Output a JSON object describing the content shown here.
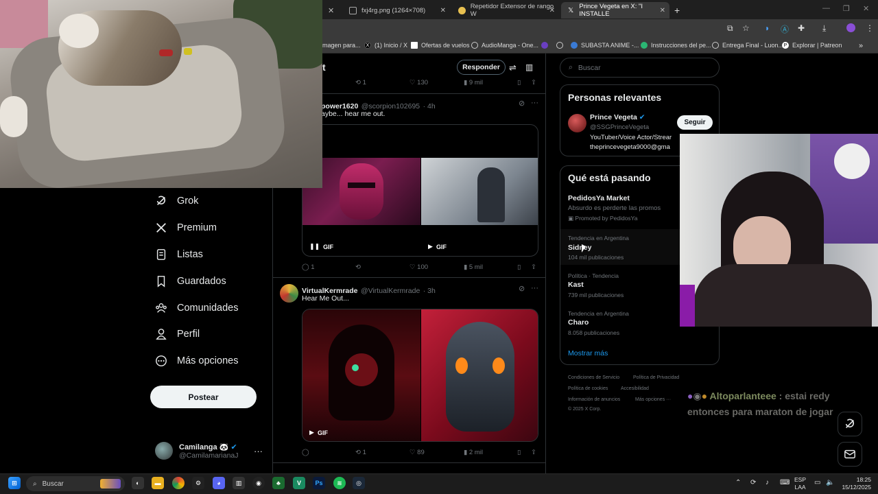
{
  "browser": {
    "tabs": [
      {
        "label": "fxj4rg.png (1264×708)"
      },
      {
        "label": "Repetidor Extensor de rango W"
      },
      {
        "label": "Prince Vegeta en X: \"I INSTALLE"
      }
    ],
    "new_tab": "+",
    "bookmarks": [
      "magen para...",
      "(1) Inicio / X",
      "Ofertas de vuelos",
      "AudioManga - One...",
      "SUBASTA ANIME -...",
      "Instrucciones del pe...",
      "Entrega Final - Luon...",
      "Explorar | Patreon"
    ]
  },
  "nav": {
    "items": [
      {
        "label": "Grok"
      },
      {
        "label": "Premium"
      },
      {
        "label": "Listas"
      },
      {
        "label": "Guardados"
      },
      {
        "label": "Comunidades"
      },
      {
        "label": "Perfil"
      },
      {
        "label": "Más opciones"
      }
    ],
    "post_button": "Postear",
    "profile": {
      "name": "Camilanga 🐼",
      "handle": "@CamilamarianaJ",
      "more": "···"
    }
  },
  "feed": {
    "header_fragment": "t",
    "reply_button": "Responder",
    "top_actions": {
      "reposts": "1",
      "likes": "130",
      "views": "9 mil"
    },
    "tweet1": {
      "name": "power1620",
      "handle": "@scorpion102695",
      "time": "· 4h",
      "text": "aybe... hear me out.",
      "gif_label_1": "GIF",
      "gif_label_2": "GIF",
      "replies": "1",
      "likes": "100",
      "views": "5 mil"
    },
    "tweet2": {
      "name": "VirtualKermrade",
      "handle": "@VirtualKermrade",
      "time": "· 3h",
      "text": "Hear Me Out...",
      "gif_label": "GIF",
      "reposts": "1",
      "likes": "89",
      "views": "2 mil"
    }
  },
  "sidebar_right": {
    "search_placeholder": "Buscar",
    "relevant_title": "Personas relevantes",
    "person": {
      "name": "Prince Vegeta",
      "handle": "@SSGPrinceVegeta",
      "bio_line1": "YouTuber/Voice Actor/Strear",
      "bio_line2": "theprincevegeta9000@gma",
      "follow": "Seguir"
    },
    "trends_title": "Qué está pasando",
    "trends": [
      {
        "category": "",
        "name": "PedidosYa Market",
        "count": "Absurdo es perderte las promos",
        "promoted": "Promoted by PedidosYa"
      },
      {
        "category": "Tendencia en Argentina",
        "name": "Sidney",
        "count": "104 mil publicaciones"
      },
      {
        "category": "Política · Tendencia",
        "name": "Kast",
        "count": "739 mil publicaciones"
      },
      {
        "category": "Tendencia en Argentina",
        "name": "Charo",
        "count": "8.058 publicaciones"
      }
    ],
    "show_more": "Mostrar más",
    "footer": [
      "Condiciones de Servicio",
      "Política de Privacidad",
      "Política de cookies",
      "Accesibilidad",
      "Información de anuncios",
      "Más opciones ···",
      "© 2025 X Corp."
    ]
  },
  "chat_overlay": {
    "user": "Altoparlanteee",
    "message_1": ": estai redy",
    "message_2": "entonces para maraton de jogar"
  },
  "taskbar": {
    "search": "Buscar",
    "lang_1": "ESP",
    "lang_2": "LAA",
    "time": "18:25",
    "date": "15/12/2025"
  },
  "colors": {
    "x_bg": "#000000",
    "x_border": "#2f3336",
    "x_text": "#e7e9ea",
    "x_muted": "#71767b",
    "x_link": "#1d9bf0"
  }
}
